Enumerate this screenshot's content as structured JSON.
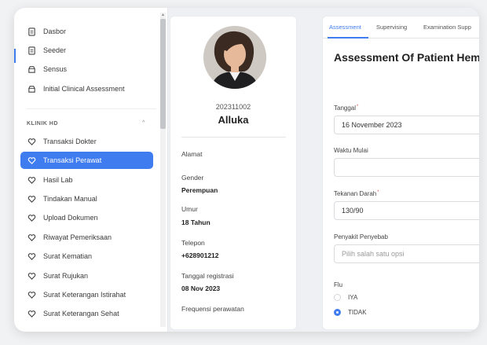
{
  "sidebar": {
    "top_items": [
      {
        "label": "Dasbor",
        "icon": "document-icon"
      },
      {
        "label": "Seeder",
        "icon": "document-icon"
      },
      {
        "label": "Sensus",
        "icon": "box-icon"
      },
      {
        "label": "Initial Clinical Assessment",
        "icon": "box-icon"
      }
    ],
    "section_label": "KLINIK HD",
    "section_items": [
      {
        "label": "Transaksi Dokter",
        "active": false
      },
      {
        "label": "Transaksi Perawat",
        "active": true
      },
      {
        "label": "Hasil Lab",
        "active": false
      },
      {
        "label": "Tindakan Manual",
        "active": false
      },
      {
        "label": "Upload Dokumen",
        "active": false
      },
      {
        "label": "Riwayat Pemeriksaan",
        "active": false
      },
      {
        "label": "Surat Kematian",
        "active": false
      },
      {
        "label": "Surat Rujukan",
        "active": false
      },
      {
        "label": "Surat Keterangan Istirahat",
        "active": false
      },
      {
        "label": "Surat Keterangan Sehat",
        "active": false
      }
    ]
  },
  "patient": {
    "id": "202311002",
    "name": "Alluka",
    "alamat_label": "Alamat",
    "gender_label": "Gender",
    "gender_value": "Perempuan",
    "umur_label": "Umur",
    "umur_value": "18 Tahun",
    "telepon_label": "Telepon",
    "telepon_value": "+628901212",
    "registrasi_label": "Tanggal registrasi",
    "registrasi_value": "08 Nov 2023",
    "frekuensi_label": "Frequensi perawatan"
  },
  "form": {
    "tabs": [
      "Assessment",
      "Supervising",
      "Examination Supp"
    ],
    "title": "Assessment Of Patient Hem",
    "tanggal_label": "Tanggal",
    "tanggal_value": "16 November 2023",
    "waktu_label": "Waktu Mulai",
    "waktu_value": "",
    "tekanan_label": "Tekanan Darah",
    "tekanan_value": "130/90",
    "penyakit_label": "Penyakit Penyebab",
    "penyakit_placeholder": "Pilih salah satu opsi",
    "flu_label": "Flu",
    "flu_options": [
      {
        "label": "IYA",
        "selected": false
      },
      {
        "label": "TIDAK",
        "selected": true
      }
    ]
  },
  "colors": {
    "accent": "#3f7cf0",
    "required": "#e05555"
  }
}
